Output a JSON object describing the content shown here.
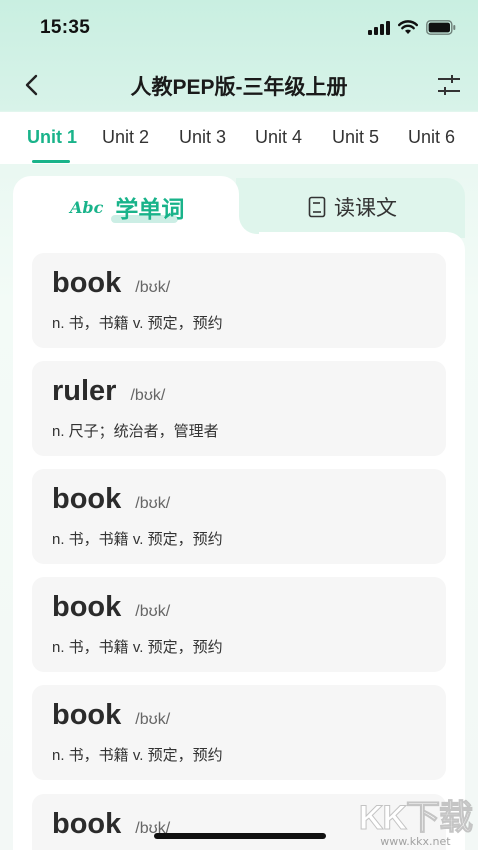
{
  "status_bar": {
    "time": "15:35"
  },
  "nav": {
    "title": "人教PEP版-三年级上册"
  },
  "unit_tabs": [
    {
      "label": "Unit 1",
      "active": true
    },
    {
      "label": "Unit 2",
      "active": false
    },
    {
      "label": "Unit 3",
      "active": false
    },
    {
      "label": "Unit 4",
      "active": false
    },
    {
      "label": "Unit 5",
      "active": false
    },
    {
      "label": "Unit 6",
      "active": false
    }
  ],
  "segments": {
    "vocab_icon_text": "Abc",
    "vocab_label": "学单词",
    "read_label": "读课文",
    "active": "vocab"
  },
  "words": [
    {
      "word": "book",
      "phonetic": "/bʊk/",
      "meaning": "n. 书，书籍  v. 预定，预约"
    },
    {
      "word": "ruler",
      "phonetic": "/bʊk/",
      "meaning": "n. 尺子；统治者，管理者"
    },
    {
      "word": "book",
      "phonetic": "/bʊk/",
      "meaning": "n. 书，书籍  v. 预定，预约"
    },
    {
      "word": "book",
      "phonetic": "/bʊk/",
      "meaning": "n. 书，书籍  v. 预定，预约"
    },
    {
      "word": "book",
      "phonetic": "/bʊk/",
      "meaning": "n. 书，书籍  v. 预定，预约"
    },
    {
      "word": "book",
      "phonetic": "/bʊk/",
      "meaning": ""
    }
  ],
  "watermark": {
    "text": "KK下载",
    "url": "www.kkx.net"
  },
  "colors": {
    "accent": "#19b38a",
    "card_bg": "#f6f6f6",
    "header_bg": "#c9efe1"
  }
}
